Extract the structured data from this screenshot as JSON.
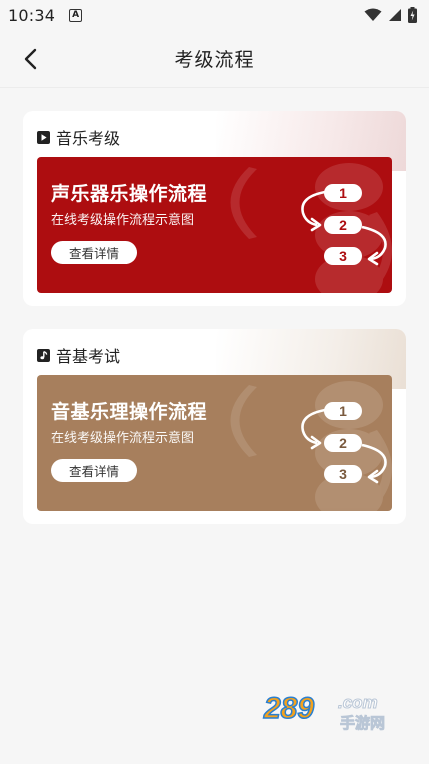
{
  "status_bar": {
    "time": "10:34",
    "notification_letter": "A"
  },
  "header": {
    "title": "考级流程"
  },
  "sections": [
    {
      "title": "音乐考级",
      "icon": "play-icon",
      "banner": {
        "title": "声乐器乐操作流程",
        "subtitle": "在线考级操作流程示意图",
        "button_label": "查看详情",
        "color": "#ad0d10",
        "step_text_color": "#ad0d10",
        "steps": [
          "1",
          "2",
          "3"
        ]
      }
    },
    {
      "title": "音基考试",
      "icon": "music-note-icon",
      "banner": {
        "title": "音基乐理操作流程",
        "subtitle": "在线考级操作流程示意图",
        "button_label": "查看详情",
        "color": "#a77f5d",
        "step_text_color": "#7a5a3e",
        "steps": [
          "1",
          "2",
          "3"
        ]
      }
    }
  ],
  "watermark": {
    "main": "289",
    "domain": ".com",
    "sub": "手游网"
  }
}
